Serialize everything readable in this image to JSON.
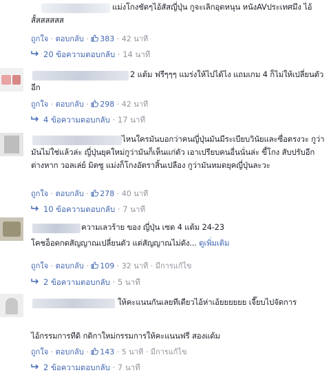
{
  "comments": [
    {
      "text": "แม่งโกงชัดๆไอ้สัสญี่ปุ่น กูจะเลิกอุดหนุน หนังAVประเทศมึง ไอ้สั้สสสสสส",
      "like_label": "ถูกใจ",
      "reply_label": "ตอบกลับ",
      "likes": "383",
      "time": "42 นาที",
      "replies_label": "20 ข้อความตอบกลับ",
      "replies_time": "14 นาที"
    },
    {
      "text": "2 แต้ม ฟรีๆๆๆ แมร่งให้ไปได้ไง แถมเกม 4 ก็ไม่ให้เปลี่ยนตัวอีก",
      "like_label": "ถูกใจ",
      "reply_label": "ตอบกลับ",
      "likes": "298",
      "time": "42 นาที",
      "replies_label": "4 ข้อความตอบกลับ",
      "replies_time": "17 นาที"
    },
    {
      "text": "ไหนใครมันบอกว่าคนญี่ปุ่นมันมีระเบียบวินัยและซื่อตรงวะ กูว่ามันไม่ใช่แล้วล่ะ ญี่ปุ่นยุคใหม่กูว่ามันก็เห็นแก่ตัว เอาเปรียบคนอื่นนั่นล่ะ ขี้โกง สับปรับอีกต่างหาก วอลเล่ย์ มิตซู แม่งก็โกงอัตราสิ้นเปลือง กูว่ามันหมดยุคญี่ปุ่นละวะ",
      "like_label": "ถูกใจ",
      "reply_label": "ตอบกลับ",
      "likes": "278",
      "time": "40 นาที",
      "replies_label": "10 ข้อความตอบกลับ",
      "replies_time": "7 นาที"
    },
    {
      "text": "ความเลวร้าย ของ ญี่ปุ่น เซต 4 แต้ม 24-23",
      "text2": "โคชอ็อดกดสัญญาณเปลี่ยนตัว แต่สัญญาณไม่ดัง...",
      "see_more": "ดูเพิ่มเติม",
      "like_label": "ถูกใจ",
      "reply_label": "ตอบกลับ",
      "likes": "109",
      "time": "32 นาที",
      "edited": "มีการแก้ไข",
      "replies_label": "2 ข้อความตอบกลับ",
      "replies_time": "5 นาที"
    },
    {
      "text": "ให้คะแนนกันเลยทีเดียวไอ้ห่าเอ้ยยยยยย เจี๊ยบไปจัดการ",
      "text2": "ไอ้กรรมการทีดิ กติกาใหม่กรรมการให้คะแนนฟรี สองแต้ม",
      "like_label": "ถูกใจ",
      "reply_label": "ตอบกลับ",
      "likes": "143",
      "time": "5 นาที",
      "edited": "มีการแก้ไข",
      "replies_label": "2 ข้อความตอบกลับ",
      "replies_time": "7 นาที"
    }
  ]
}
